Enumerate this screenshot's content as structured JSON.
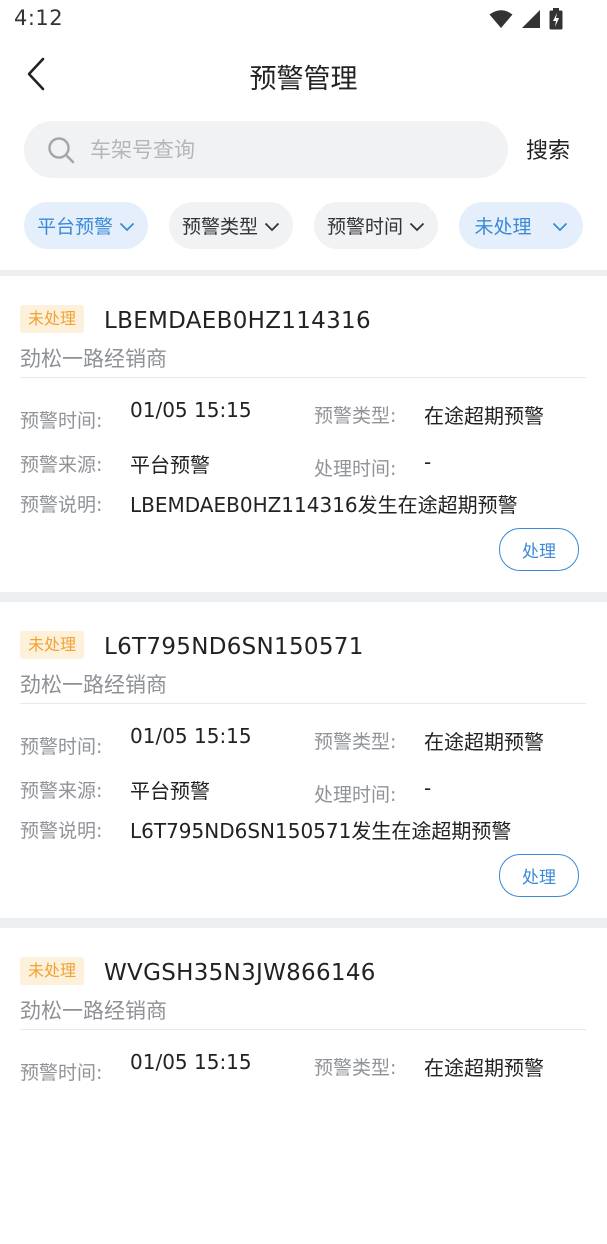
{
  "status_bar": {
    "time": "4:12"
  },
  "header": {
    "title": "预警管理",
    "back_icon": "chevron-left-icon"
  },
  "search": {
    "placeholder": "车架号查询",
    "value": "",
    "button_label": "搜索"
  },
  "filters": [
    {
      "label": "平台预警",
      "active": true
    },
    {
      "label": "预警类型",
      "active": false
    },
    {
      "label": "预警时间",
      "active": false
    },
    {
      "label": "未处理",
      "active": true
    }
  ],
  "field_labels": {
    "time": "预警时间:",
    "type": "预警类型:",
    "source": "预警来源:",
    "handle_time": "处理时间:",
    "desc": "预警说明:"
  },
  "cards": [
    {
      "status": "未处理",
      "vin": "LBEMDAEB0HZ114316",
      "dealer": "劲松一路经销商",
      "alert_time": "01/05 15:15",
      "alert_type": "在途超期预警",
      "source": "平台预警",
      "handle_time": "-",
      "description": "LBEMDAEB0HZ114316发生在途超期预警",
      "action_label": "处理"
    },
    {
      "status": "未处理",
      "vin": "L6T795ND6SN150571",
      "dealer": "劲松一路经销商",
      "alert_time": "01/05 15:15",
      "alert_type": "在途超期预警",
      "source": "平台预警",
      "handle_time": "-",
      "description": "L6T795ND6SN150571发生在途超期预警",
      "action_label": "处理"
    },
    {
      "status": "未处理",
      "vin": "WVGSH35N3JW866146",
      "dealer": "劲松一路经销商",
      "alert_time": "01/05 15:15",
      "alert_type": "在途超期预警",
      "source": "",
      "handle_time": "",
      "description": "",
      "action_label": ""
    }
  ],
  "colors": {
    "accent": "#3a8ad9",
    "badge_bg": "#fdf1dc",
    "badge_text": "#f2a233"
  }
}
